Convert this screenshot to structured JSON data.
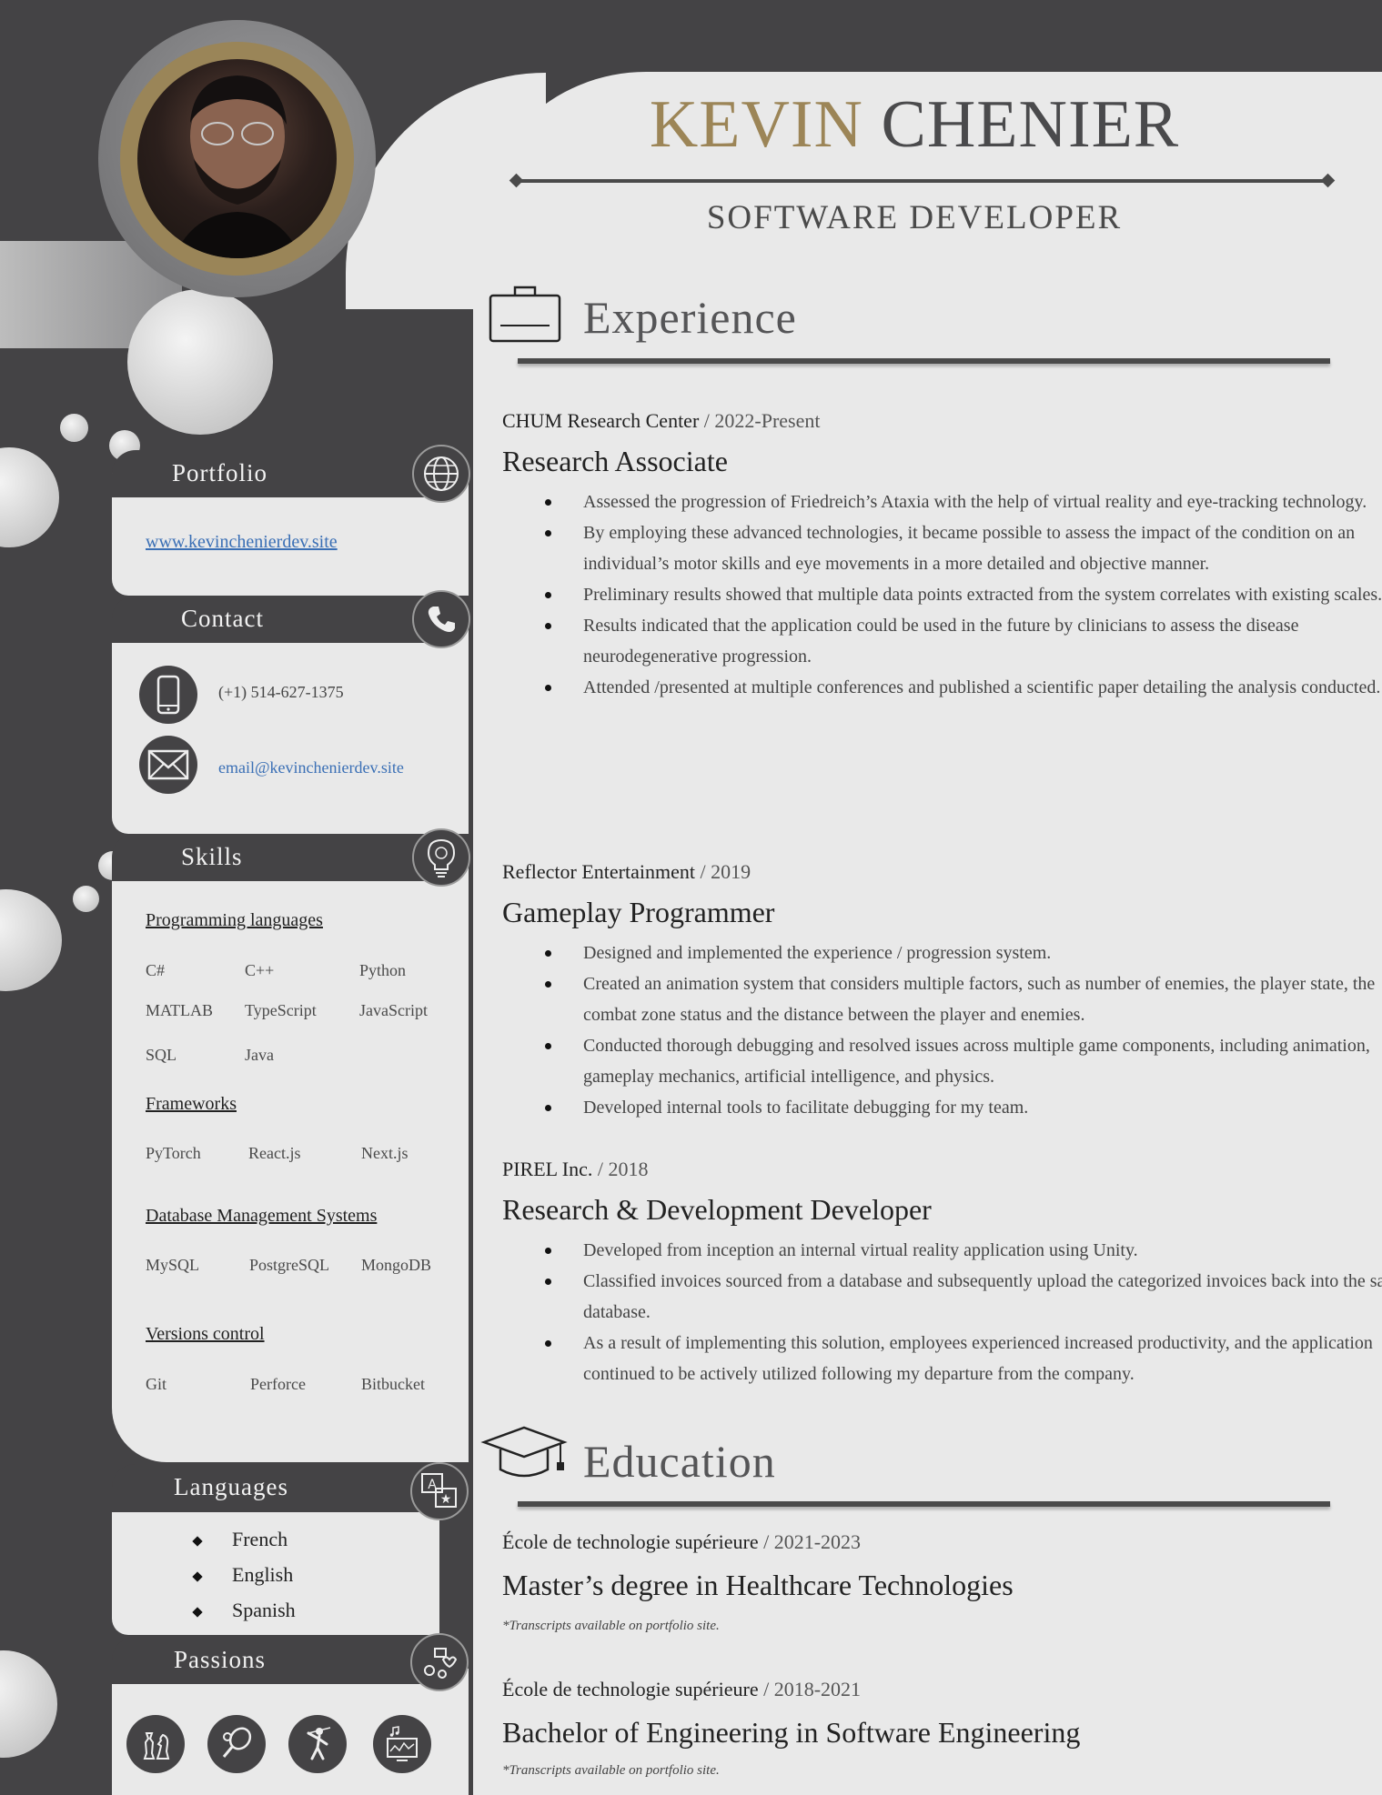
{
  "header": {
    "first_name": "KEVIN",
    "last_name": "CHENIER",
    "title": "SOFTWARE DEVELOPER"
  },
  "portfolio": {
    "heading": "Portfolio",
    "icon": "globe-icon",
    "url": "www.kevinchenierdev.site"
  },
  "contact": {
    "heading": "Contact",
    "icon": "phone-icon",
    "phone": "(+1) 514-627-1375",
    "email": "email@kevinchenierdev.site"
  },
  "skills": {
    "heading": "Skills",
    "icon": "lightbulb-icon",
    "groups": [
      {
        "title": "Programming languages",
        "items": [
          "C#",
          "C++",
          "Python",
          "MATLAB",
          "TypeScript",
          "JavaScript",
          "SQL",
          "Java"
        ]
      },
      {
        "title": "Frameworks",
        "items": [
          "PyTorch",
          "React.js",
          "Next.js"
        ]
      },
      {
        "title": "Database Management Systems",
        "items": [
          "MySQL",
          "PostgreSQL",
          "MongoDB"
        ]
      },
      {
        "title": "Versions control",
        "items": [
          "Git",
          "Perforce",
          "Bitbucket"
        ]
      }
    ]
  },
  "languages": {
    "heading": "Languages",
    "icon": "translate-icon",
    "items": [
      "French",
      "English",
      "Spanish"
    ]
  },
  "passions": {
    "heading": "Passions",
    "icon": "hobbies-icon",
    "items": [
      "chess-icon",
      "tennis-icon",
      "golf-icon",
      "music-computer-icon"
    ]
  },
  "experience": {
    "heading": "Experience",
    "icon": "briefcase-icon",
    "jobs": [
      {
        "company": "CHUM Research Center",
        "years": " / 2022-Present",
        "role": "Research Associate",
        "bullets": [
          "Assessed the progression of Friedreich’s Ataxia with the help of virtual reality and eye-tracking technology.",
          "By employing these advanced technologies, it became possible to assess the impact of the condition on an individual’s motor skills and eye movements in a more detailed and objective manner.",
          "Preliminary results showed that multiple data points extracted from the system correlates with existing scales.",
          "Results indicated that the application could be used in the future by clinicians to assess the disease neurodegenerative progression.",
          "Attended /presented at multiple conferences and published a scientific paper detailing the analysis conducted."
        ]
      },
      {
        "company": "Reflector Entertainment",
        "years": " / 2019",
        "role": "Gameplay Programmer",
        "bullets": [
          "Designed and implemented the experience / progression system.",
          "Created an animation system that considers multiple factors, such as number of enemies, the player state, the combat zone status and the distance between the player and enemies.",
          "Conducted thorough debugging and resolved issues across multiple game components, including animation, gameplay mechanics, artificial intelligence, and physics.",
          "Developed internal tools to facilitate debugging for my team."
        ]
      },
      {
        "company": "PIREL Inc.",
        "years": " / 2018",
        "role": "Research & Development Developer",
        "bullets": [
          "Developed from inception an internal virtual reality application using Unity.",
          "Classified invoices sourced from a database and subsequently upload the categorized invoices back into the same database.",
          "As a result of implementing this solution, employees experienced increased productivity, and the application continued to be actively utilized following my departure from the company."
        ]
      }
    ]
  },
  "education": {
    "heading": "Education",
    "icon": "graduation-cap-icon",
    "entries": [
      {
        "school": "École de technologie supérieure",
        "years": " / 2021-2023",
        "degree": "Master’s degree in Healthcare Technologies",
        "note": "*Transcripts available on portfolio site."
      },
      {
        "school": "École de technologie supérieure",
        "years": " / 2018-2021",
        "degree": "Bachelor of Engineering in Software Engineering",
        "note": "*Transcripts available on portfolio site."
      }
    ]
  }
}
